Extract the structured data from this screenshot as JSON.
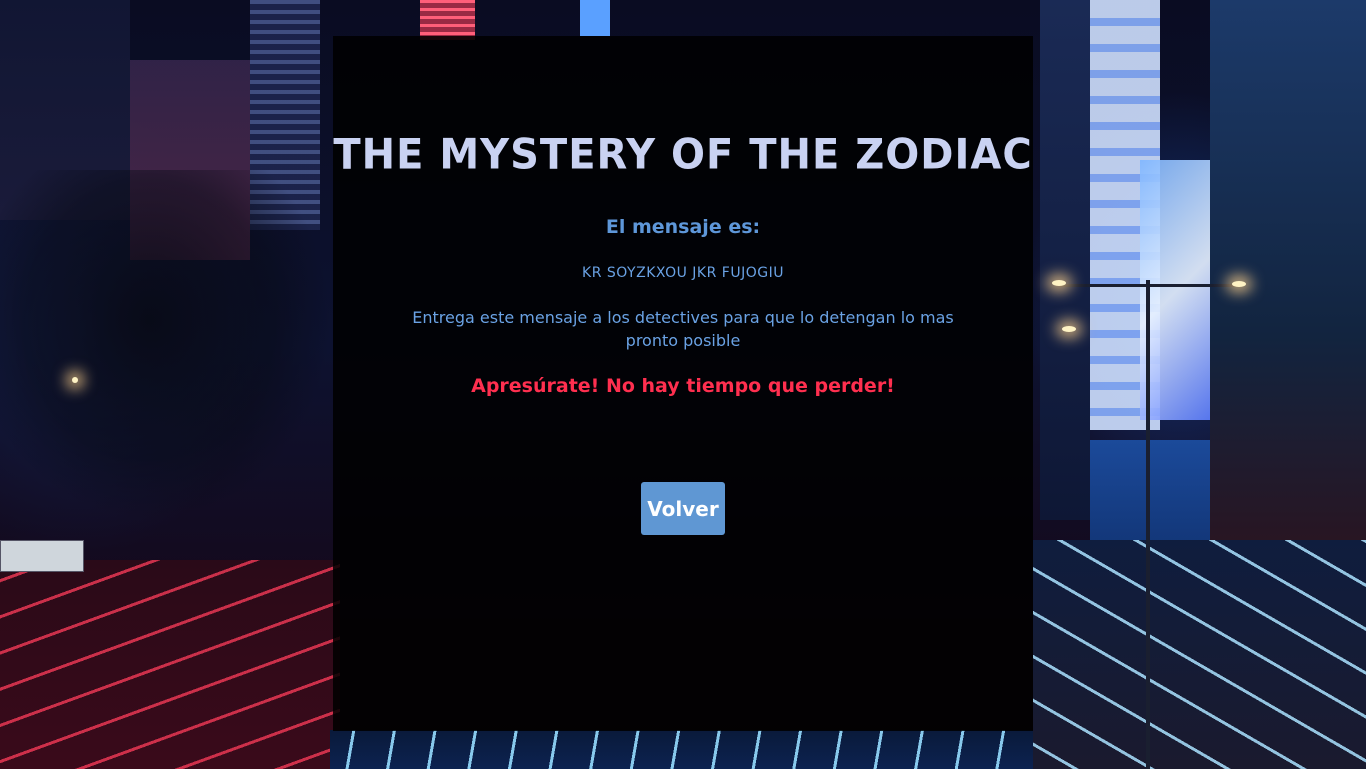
{
  "panel": {
    "title": "THE MYSTERY OF THE ZODIAC",
    "message_label": "El mensaje es:",
    "cipher_text": "KR SOYZKXOU JKR FUJOGIU",
    "instructions": "Entrega este mensaje a los detectives para que lo detengan lo mas pronto posible",
    "warning": "Apresúrate! No hay tiempo que perder!",
    "back_button_label": "Volver"
  },
  "colors": {
    "title": "#c9d2f2",
    "text_blue": "#6aa2e4",
    "warning_red": "#ff2f4f",
    "button_bg": "#5f97d3",
    "panel_bg": "#000000"
  }
}
